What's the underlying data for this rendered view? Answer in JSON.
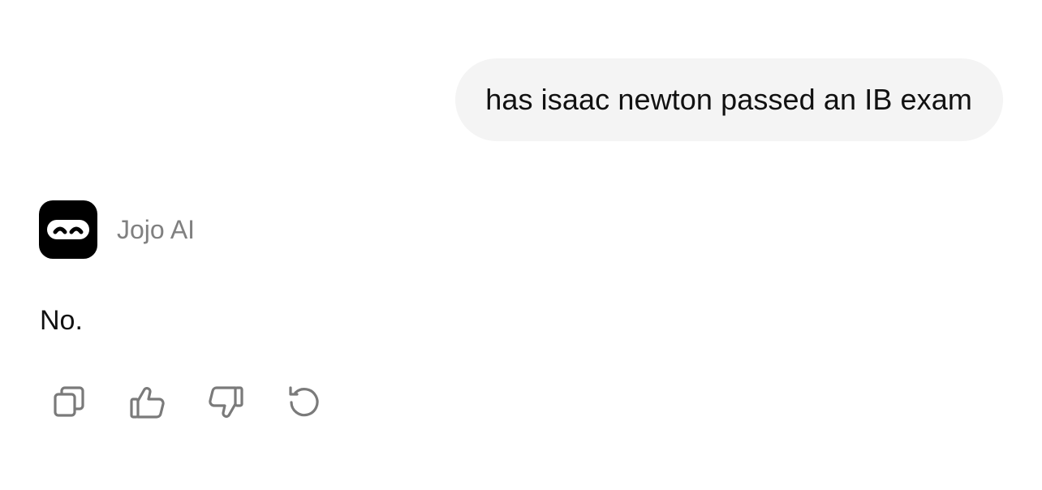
{
  "conversation": {
    "user_message": "has isaac newton passed an IB exam",
    "assistant": {
      "name": "Jojo AI",
      "avatar_icon": "ninja-mask-icon",
      "message": "No."
    }
  },
  "actions": [
    {
      "icon": "copy-icon",
      "label": "Copy"
    },
    {
      "icon": "thumbs-up-icon",
      "label": "Good response"
    },
    {
      "icon": "thumbs-down-icon",
      "label": "Bad response"
    },
    {
      "icon": "regenerate-icon",
      "label": "Regenerate"
    }
  ],
  "colors": {
    "user_bubble_bg": "#f4f4f4",
    "assistant_name": "#808080",
    "icon_stroke": "#7a7a7a",
    "avatar_bg": "#000000"
  }
}
